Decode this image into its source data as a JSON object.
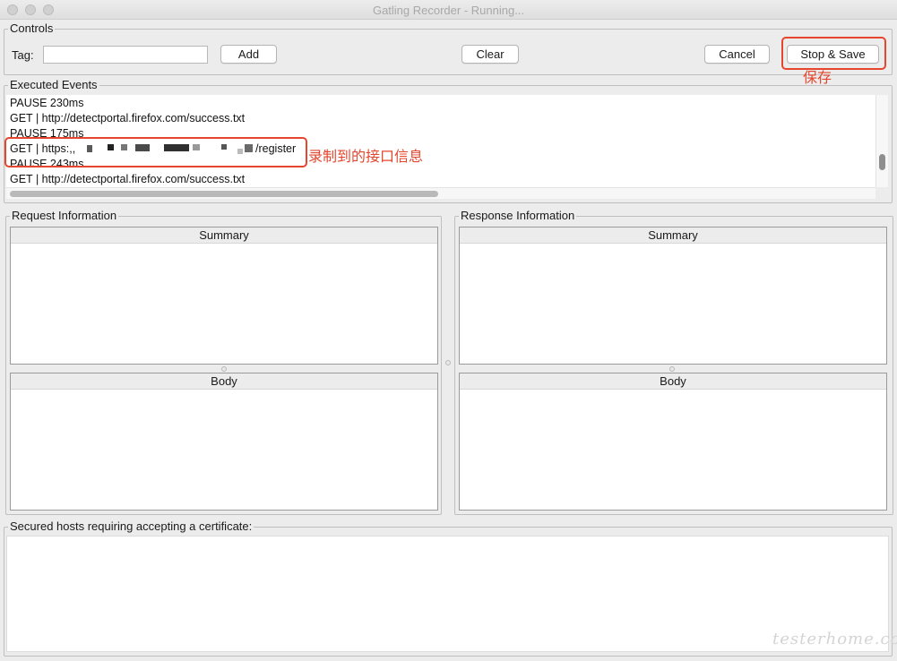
{
  "window": {
    "title": "Gatling Recorder - Running..."
  },
  "controls": {
    "legend": "Controls",
    "tag_label": "Tag:",
    "tag_value": "",
    "add_label": "Add",
    "clear_label": "Clear",
    "cancel_label": "Cancel",
    "stop_save_label": "Stop & Save"
  },
  "events": {
    "legend": "Executed Events",
    "items": [
      {
        "text": "PAUSE 230ms"
      },
      {
        "text": "GET | http://detectportal.firefox.com/success.txt"
      },
      {
        "text": "PAUSE 175ms"
      },
      {
        "text": "GET | https:,,",
        "suffix": "/register"
      },
      {
        "text": "PAUSE 243ms"
      },
      {
        "text": "GET | http://detectportal.firefox.com/success.txt"
      }
    ]
  },
  "request": {
    "legend": "Request Information",
    "summary_title": "Summary",
    "body_title": "Body"
  },
  "response": {
    "legend": "Response Information",
    "summary_title": "Summary",
    "body_title": "Body"
  },
  "certificates": {
    "legend": "Secured hosts requiring accepting a certificate:"
  },
  "annotations": {
    "save_note": "保存",
    "api_note": "录制到的接口信息",
    "color": "#e5462d"
  },
  "watermark": "testerhome.com"
}
